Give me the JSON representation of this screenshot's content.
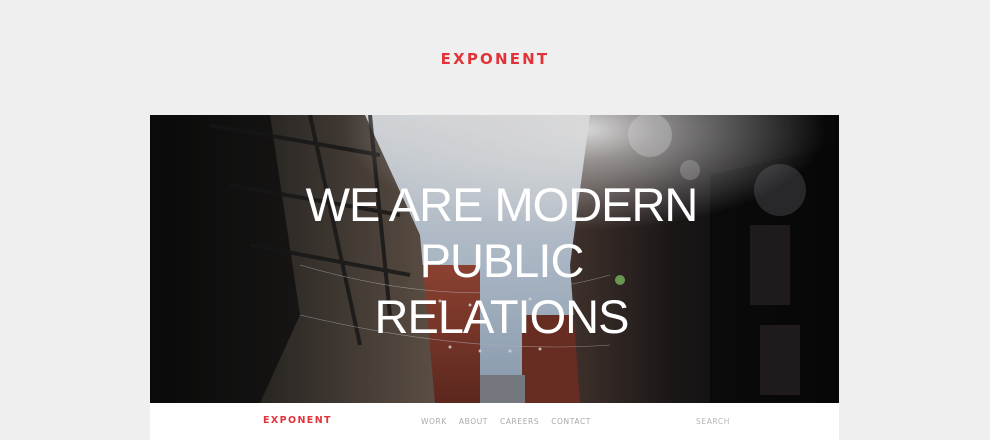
{
  "header": {
    "logo_text": "EXPONENT",
    "brand_color": "#e2333a"
  },
  "hero": {
    "headline_lines": [
      "WE ARE MODERN",
      "PUBLIC",
      "RELATIONS"
    ],
    "image_icon": "alley-photo-background"
  },
  "navbar": {
    "logo_text": "EXPONENT",
    "links": [
      "WORK",
      "ABOUT",
      "CAREERS",
      "CONTACT"
    ],
    "search_label": "SEARCH"
  }
}
